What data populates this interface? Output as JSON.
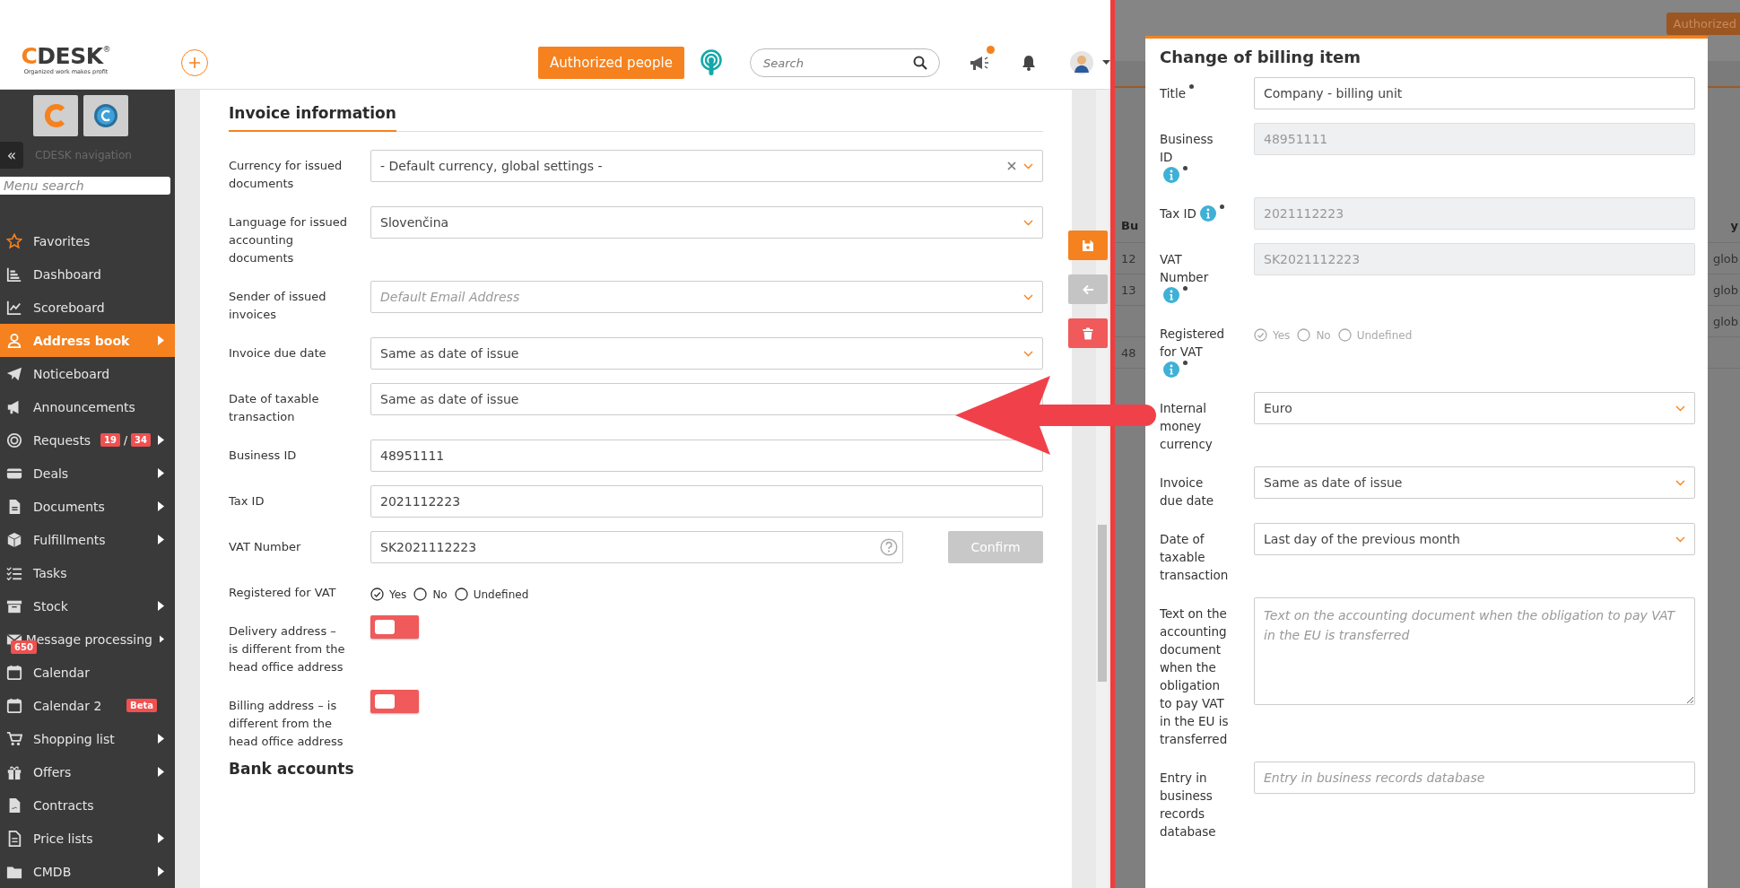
{
  "header": {
    "logo": {
      "text": "CDESK",
      "mark": "®",
      "tagline": "Organized work makes profit"
    },
    "authorized_button": "Authorized people",
    "search": {
      "placeholder": "Search"
    },
    "announcements": {
      "unread": true
    }
  },
  "sidebar": {
    "collapse_button": "«",
    "title": "CDESK navigation",
    "search": {
      "placeholder": "Menu search"
    },
    "items": [
      {
        "label": "Favorites",
        "selected": false,
        "submenu": false
      },
      {
        "label": "Dashboard",
        "selected": false,
        "submenu": false
      },
      {
        "label": "Scoreboard",
        "selected": false,
        "submenu": false
      },
      {
        "label": "Address book",
        "selected": true,
        "submenu": true
      },
      {
        "label": "Noticeboard",
        "selected": false,
        "submenu": false
      },
      {
        "label": "Announcements",
        "selected": false,
        "submenu": false
      },
      {
        "label": "Requests",
        "selected": false,
        "submenu": true,
        "badges": [
          {
            "text": "19",
            "kind": "count"
          },
          {
            "text": "/",
            "kind": "separator"
          },
          {
            "text": "34",
            "kind": "count"
          }
        ]
      },
      {
        "label": "Deals",
        "selected": false,
        "submenu": true
      },
      {
        "label": "Documents",
        "selected": false,
        "submenu": true
      },
      {
        "label": "Fulfillments",
        "selected": false,
        "submenu": true
      },
      {
        "label": "Tasks",
        "selected": false,
        "submenu": false
      },
      {
        "label": "Stock",
        "selected": false,
        "submenu": true
      },
      {
        "label": "Message processing",
        "selected": false,
        "submenu": true,
        "badges": [
          {
            "text": "650",
            "kind": "icon_count"
          }
        ]
      },
      {
        "label": "Calendar",
        "selected": false,
        "submenu": false
      },
      {
        "label": "Calendar 2",
        "selected": false,
        "submenu": false,
        "badges": [
          {
            "text": "Beta",
            "kind": "tag"
          }
        ]
      },
      {
        "label": "Shopping list",
        "selected": false,
        "submenu": true
      },
      {
        "label": "Offers",
        "selected": false,
        "submenu": true
      },
      {
        "label": "Contracts",
        "selected": false,
        "submenu": false
      },
      {
        "label": "Price lists",
        "selected": false,
        "submenu": true
      },
      {
        "label": "CMDB",
        "selected": false,
        "submenu": true
      }
    ]
  },
  "form": {
    "section_title": "Invoice information",
    "fields": [
      {
        "kind": "select",
        "label": "Currency for issued documents",
        "value": "- Default currency, global settings -",
        "clearable": true
      },
      {
        "kind": "select",
        "label": "Language for issued accounting documents",
        "value": "Slovenčina"
      },
      {
        "kind": "select",
        "label": "Sender of issued invoices",
        "placeholder": "Default Email Address"
      },
      {
        "kind": "select",
        "label": "Invoice due date",
        "value": "Same as date of issue"
      },
      {
        "kind": "select",
        "label": "Date of taxable transaction",
        "value": "Same as date of issue"
      },
      {
        "kind": "text",
        "label": "Business ID",
        "value": "48951111"
      },
      {
        "kind": "text",
        "label": "Tax ID",
        "value": "2021112223"
      },
      {
        "kind": "text_help",
        "label": "VAT Number",
        "value": "SK2021112223",
        "button": {
          "label": "Confirm",
          "disabled": true
        }
      },
      {
        "kind": "radio",
        "label": "Registered for VAT",
        "options": [
          {
            "label": "Yes",
            "selected": true
          },
          {
            "label": "No",
            "selected": false
          },
          {
            "label": "Undefined",
            "selected": false
          }
        ]
      },
      {
        "kind": "toggle",
        "label": "Delivery address – is different from the head office address",
        "on": false
      },
      {
        "kind": "toggle",
        "label": "Billing address – is different from the head office address",
        "on": false
      }
    ],
    "next_section_title": "Bank accounts"
  },
  "actions": [
    {
      "kind": "save"
    },
    {
      "kind": "back"
    },
    {
      "kind": "delete"
    }
  ],
  "background": {
    "button": "Authorized",
    "column_1": "Bu",
    "column_2": "y",
    "rows": [
      {
        "column_1": "12",
        "column_2": "glob"
      },
      {
        "column_1": "13",
        "column_2": "glob"
      },
      {
        "column_2": "glob"
      },
      {
        "column_1": "48"
      }
    ]
  },
  "modal": {
    "title": "Change of billing item",
    "fields": [
      {
        "kind": "text",
        "label": "Title",
        "required": true,
        "info": false,
        "disabled": false,
        "value": "Company - billing unit"
      },
      {
        "kind": "text",
        "label": "Business ID",
        "required": true,
        "info": true,
        "disabled": true,
        "value": "48951111"
      },
      {
        "kind": "text",
        "label": "Tax ID",
        "required": true,
        "info": true,
        "disabled": true,
        "value": "2021112223"
      },
      {
        "kind": "text",
        "label": "VAT Number",
        "required": true,
        "info": true,
        "disabled": true,
        "value": "SK2021112223"
      },
      {
        "kind": "radio",
        "label": "Registered for VAT",
        "required": true,
        "info": true,
        "disabled": true,
        "options": [
          {
            "label": "Yes",
            "selected": true
          },
          {
            "label": "No",
            "selected": false
          },
          {
            "label": "Undefined",
            "selected": false
          }
        ]
      },
      {
        "kind": "select",
        "label": "Internal money currency",
        "required": false,
        "info": false,
        "disabled": false,
        "value": "Euro"
      },
      {
        "kind": "select",
        "label": "Invoice due date",
        "required": false,
        "info": false,
        "disabled": false,
        "value": "Same as date of issue"
      },
      {
        "kind": "select",
        "label": "Date of taxable transaction",
        "required": false,
        "info": false,
        "disabled": false,
        "value": "Last day of the previous month"
      },
      {
        "kind": "textarea",
        "label": "Text on the accounting document when the obligation to pay VAT in the EU is transferred",
        "required": false,
        "info": false,
        "disabled": false,
        "placeholder": "Text on the accounting document when the obligation to pay VAT in the EU is transferred"
      },
      {
        "kind": "text",
        "label": "Entry in business records database",
        "required": false,
        "info": false,
        "disabled": false,
        "placeholder": "Entry in business records database"
      }
    ]
  }
}
